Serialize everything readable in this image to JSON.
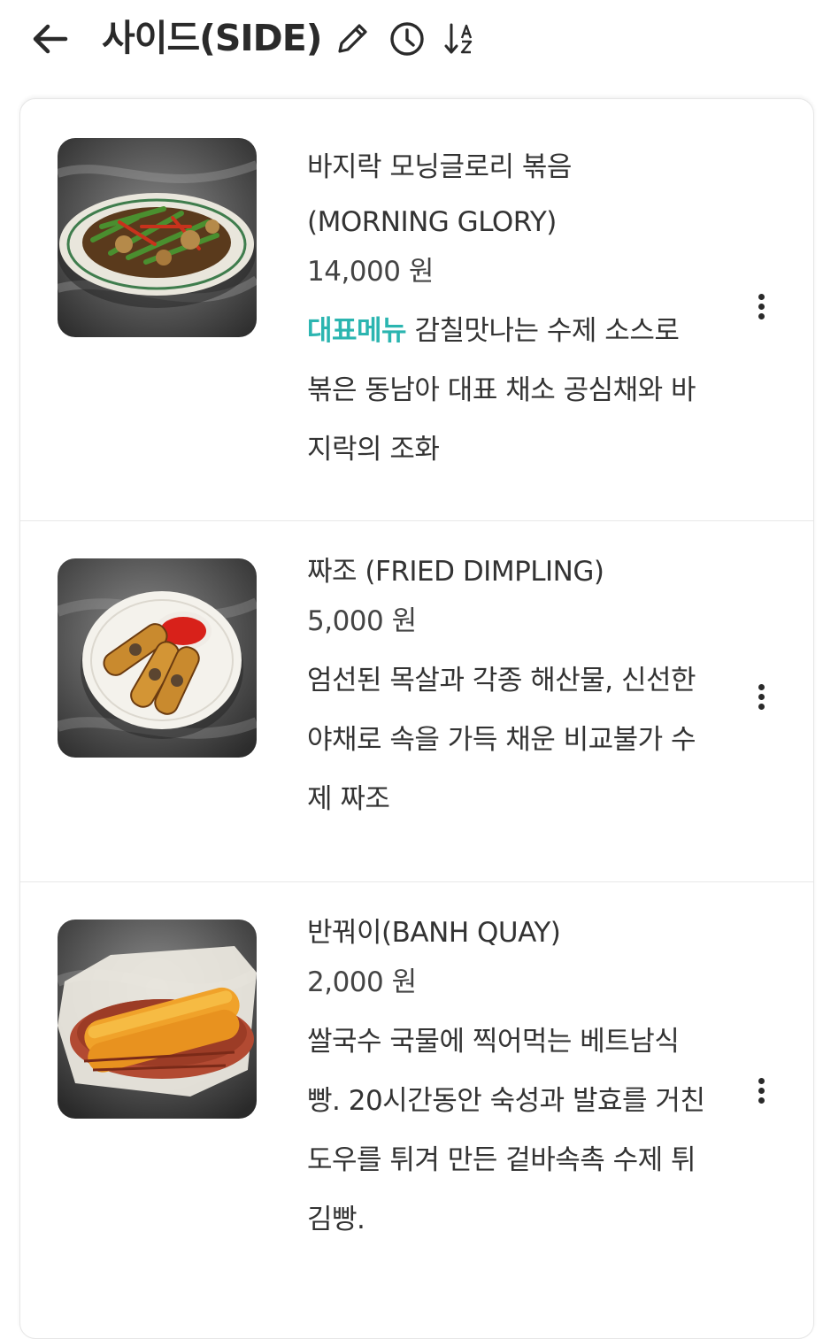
{
  "header": {
    "title": "사이드(SIDE)"
  },
  "icons": {
    "back": "arrow-left-icon",
    "edit": "pencil-icon",
    "history": "clock-icon",
    "sort": "sort-alpha-icon",
    "more": "more-vertical-icon"
  },
  "colors": {
    "accent": "#2bb5b0",
    "text": "#333333",
    "divider": "#e8e8e8"
  },
  "menu": {
    "items": [
      {
        "name_lines": [
          "바지락 모닝글로리 볶음",
          "(MORNING GLORY)"
        ],
        "price": "14,000 원",
        "badge": "대표메뉴",
        "desc_lines": [
          " 감칠맛나는 수제 소스로",
          "볶은 동남아 대표 채소 공심채와 바",
          "지락의 조화"
        ]
      },
      {
        "name_lines": [
          "짜조 (FRIED DIMPLING)"
        ],
        "price": "5,000 원",
        "desc_lines": [
          "엄선된 목살과 각종 해산물, 신선한",
          "야채로 속을 가득 채운 비교불가 수",
          "제 짜조"
        ]
      },
      {
        "name_lines": [
          "반꿔이(BANH QUAY)"
        ],
        "price": "2,000 원",
        "desc_lines": [
          "쌀국수 국물에 찍어먹는 베트남식",
          "빵. 20시간동안 숙성과 발효를 거친",
          "도우를 튀겨 만든 겉바속촉 수제 튀",
          "김빵."
        ]
      }
    ]
  }
}
